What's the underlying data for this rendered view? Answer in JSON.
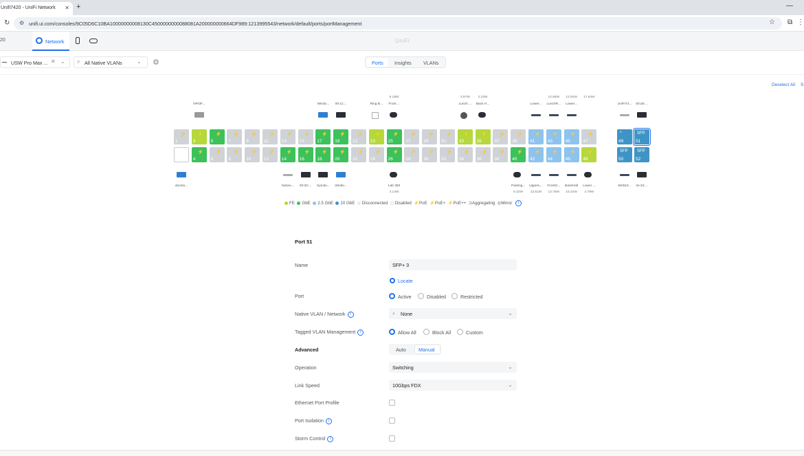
{
  "browser": {
    "tab_title": "Unifi7420 - UniFi Network",
    "url": "unifi.ui.com/consoles/9C05D6C10BA10000000008130C4500000000088081A200000000664DF989:1213995543/network/default/ports/portManagement"
  },
  "topbar": {
    "prefix": "20",
    "network_label": "Network",
    "brand": "UniFi"
  },
  "filters": {
    "device": "USW Pro Max ...",
    "vlan": "All Native VLANs"
  },
  "views": {
    "tabs": [
      "Ports",
      "Insights",
      "VLANs"
    ],
    "selected": "Ports"
  },
  "deselect_all": "Deselect All",
  "deselect_s": "S",
  "ports": {
    "top": [
      {
        "n": "1",
        "c": "dis"
      },
      {
        "n": "3",
        "c": "fe"
      },
      {
        "n": "5",
        "c": "gbe"
      },
      {
        "n": "7",
        "c": "dis"
      },
      {
        "n": "9",
        "c": "dis"
      },
      {
        "n": "11",
        "c": "dis"
      },
      {
        "n": "13",
        "c": "dis"
      },
      {
        "n": "15",
        "c": "dis"
      },
      {
        "n": "17",
        "c": "gbe"
      },
      {
        "n": "19",
        "c": "gbe"
      },
      {
        "n": "21",
        "c": "dis"
      },
      {
        "n": "23",
        "c": "fe"
      },
      {
        "n": "25",
        "c": "gbe"
      },
      {
        "n": "27",
        "c": "dis"
      },
      {
        "n": "29",
        "c": "dis"
      },
      {
        "n": "31",
        "c": "dis"
      },
      {
        "n": "33",
        "c": "fe"
      },
      {
        "n": "35",
        "c": "fe"
      },
      {
        "n": "37",
        "c": "dis"
      },
      {
        "n": "39",
        "c": "dis"
      },
      {
        "n": "41",
        "c": "25"
      },
      {
        "n": "43",
        "c": "25"
      },
      {
        "n": "45",
        "c": "25"
      },
      {
        "n": "47",
        "c": "dis"
      }
    ],
    "bottom": [
      {
        "n": "2",
        "c": "empty"
      },
      {
        "n": "4",
        "c": "gbe"
      },
      {
        "n": "6",
        "c": "dis"
      },
      {
        "n": "8",
        "c": "dis"
      },
      {
        "n": "10",
        "c": "dis"
      },
      {
        "n": "12",
        "c": "dis"
      },
      {
        "n": "14",
        "c": "gbe"
      },
      {
        "n": "16",
        "c": "gbe"
      },
      {
        "n": "18",
        "c": "gbe"
      },
      {
        "n": "20",
        "c": "gbe"
      },
      {
        "n": "22",
        "c": "dis"
      },
      {
        "n": "24",
        "c": "dis"
      },
      {
        "n": "26",
        "c": "gbe"
      },
      {
        "n": "28",
        "c": "dis"
      },
      {
        "n": "30",
        "c": "dis"
      },
      {
        "n": "32",
        "c": "dis"
      },
      {
        "n": "34",
        "c": "dis"
      },
      {
        "n": "36",
        "c": "dis"
      },
      {
        "n": "38",
        "c": "dis"
      },
      {
        "n": "40",
        "c": "gbe"
      },
      {
        "n": "42",
        "c": "25"
      },
      {
        "n": "44",
        "c": "25"
      },
      {
        "n": "46",
        "c": "25"
      },
      {
        "n": "48",
        "c": "fe"
      }
    ],
    "sfp_top": [
      {
        "n": "49",
        "t": "^",
        "c": "10g"
      },
      {
        "n": "51",
        "t": "SFP",
        "c": "10g",
        "selected": true
      }
    ],
    "sfp_bottom": [
      {
        "n": "50",
        "t": "SFP",
        "c": "10g"
      },
      {
        "n": "52",
        "t": "SFP",
        "c": "10g"
      }
    ],
    "top_labels": [
      {
        "col": 1,
        "label": "NPI3F...",
        "icon": "ap"
      },
      {
        "col": 8,
        "label": "Windo...",
        "icon": "pc"
      },
      {
        "col": 9,
        "label": "00:11:...",
        "icon": "monitor"
      },
      {
        "col": 11,
        "label": "Ring B...",
        "icon": "box"
      },
      {
        "col": 12,
        "label": "Front ...",
        "watt": "5.18W",
        "icon": "cam"
      },
      {
        "col": 16,
        "label": "Lunch ...",
        "watt": "3.57W",
        "icon": "dome"
      },
      {
        "col": 17,
        "label": "Back H...",
        "watt": "2.23W",
        "icon": "bullet"
      },
      {
        "col": 20,
        "label": "Lower...",
        "icon": "switch"
      },
      {
        "col": 21,
        "label": "LunchR...",
        "watt": "12.85W",
        "icon": "switch"
      },
      {
        "col": 22,
        "label": "Lower...",
        "watt": "12.92W",
        "icon": "switch"
      },
      {
        "col": 23,
        "label": "",
        "watt": "17.64W",
        "icon": "none"
      }
    ],
    "top_watts_extra": [],
    "sfp_top_labels": [
      {
        "label": "UniFi74...",
        "icon": "flat"
      },
      {
        "label": "00:a0:...",
        "icon": "monitor"
      }
    ],
    "bottom_labels": [
      {
        "col": 0,
        "label": "ubuntu...",
        "icon": "pc"
      },
      {
        "col": 6,
        "label": "Netwo...",
        "icon": "flat"
      },
      {
        "col": 7,
        "label": "00:20:...",
        "icon": "monitor"
      },
      {
        "col": 8,
        "label": "Synolo...",
        "icon": "monitor"
      },
      {
        "col": 9,
        "label": "Windo...",
        "icon": "pc"
      },
      {
        "col": 12,
        "label": "Lab 360",
        "watt": "4.14W",
        "icon": "bullet"
      },
      {
        "col": 19,
        "label": "Parking...",
        "watt": "6.42W",
        "icon": "cam"
      },
      {
        "col": 20,
        "label": "UpperL...",
        "watt": "13.51W",
        "icon": "switch"
      },
      {
        "col": 21,
        "label": "FrontO...",
        "watt": "13.76W",
        "icon": "switch"
      },
      {
        "col": 22,
        "label": "BackHall",
        "watt": "15.42W",
        "icon": "switch"
      },
      {
        "col": 23,
        "label": "Lower ...",
        "watt": "4.79W",
        "icon": "bullet"
      }
    ],
    "sfp_bottom_labels": [
      {
        "label": "MS510...",
        "icon": "switch"
      },
      {
        "label": "2e:34:...",
        "icon": "monitor"
      }
    ]
  },
  "legend": {
    "items": [
      "FE",
      "GbE",
      "2.5 GbE",
      "10 GbE",
      "Disconnected",
      "Disabled",
      "PoE",
      "PoE+",
      "PoE++",
      "Aggregating",
      "Mirror"
    ],
    "colors": {
      "fe": "#b5d83c",
      "gbe": "#3cc15b",
      "g25": "#8ec3ee",
      "g10": "#3f94c6",
      "dis": "#cfd2d6"
    }
  },
  "form": {
    "title": "Port 51",
    "name_label": "Name",
    "name_value": "SFP+ 3",
    "locate": "Locate",
    "port_label": "Port",
    "port_options": [
      "Active",
      "Disabled",
      "Restricted"
    ],
    "native_label": "Native VLAN / Network",
    "native_value": "None",
    "tagged_label": "Tagged VLAN Management",
    "tagged_options": [
      "Allow All",
      "Block All",
      "Custom"
    ],
    "advanced_label": "Advanced",
    "advanced_options": [
      "Auto",
      "Manual"
    ],
    "operation_label": "Operation",
    "operation_value": "Switching",
    "speed_label": "Link Speed",
    "speed_value": "10Gbps FDX",
    "ethernet_label": "Ethernet Port Profile",
    "isolation_label": "Port Isolation",
    "storm_label": "Storm Control"
  }
}
